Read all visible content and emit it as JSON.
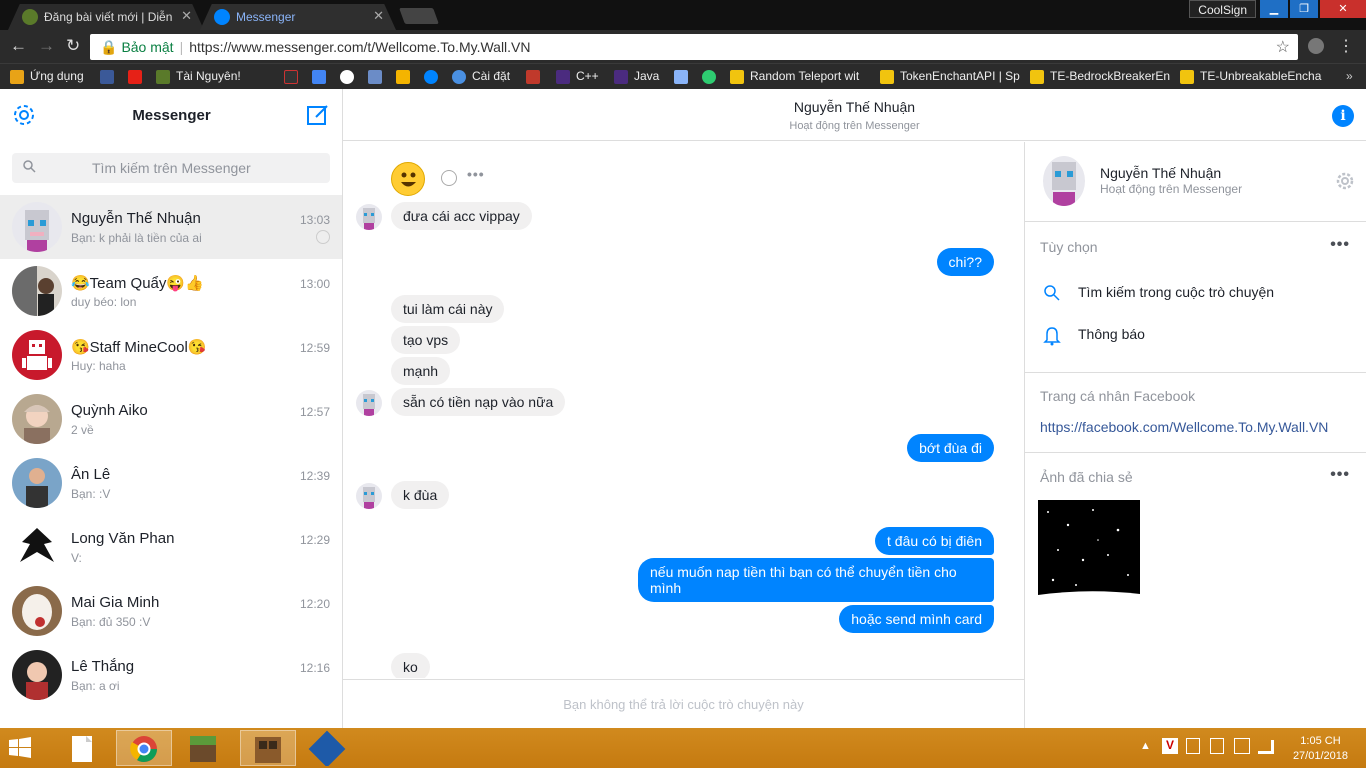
{
  "browser": {
    "tabs": [
      {
        "title": "Đăng bài viết mới | Diễn"
      },
      {
        "title": "Messenger"
      }
    ],
    "close_glyph": "✕",
    "coolsign": "CoolSign",
    "url_secure_label": "Bảo mật",
    "url": "https://www.messenger.com/t/Wellcome.To.My.Wall.VN",
    "bookmarks": [
      {
        "label": "Ứng dụng"
      },
      {
        "label": "Tài Nguyên!"
      },
      {
        "label": "Cài đặt"
      },
      {
        "label": "C++"
      },
      {
        "label": "Java"
      },
      {
        "label": "Random Teleport wit"
      },
      {
        "label": "TokenEnchantAPI | Sp"
      },
      {
        "label": "TE-BedrockBreakerEn"
      },
      {
        "label": "TE-UnbreakableEncha"
      }
    ]
  },
  "sidebar": {
    "title": "Messenger",
    "search_placeholder": "Tìm kiếm trên Messenger",
    "conversations": [
      {
        "name": "Nguyễn Thế Nhuận",
        "snippet": "Bạn: k phải là tiền của ai",
        "time": "13:03"
      },
      {
        "name": "😂Team Quẩy😜👍",
        "snippet": "duy béo: lon",
        "time": "13:00"
      },
      {
        "name": "😘Staff MineCool😘",
        "snippet": "Huy: haha",
        "time": "12:59"
      },
      {
        "name": "Quỳnh Aiko",
        "snippet": "2 về",
        "time": "12:57"
      },
      {
        "name": "Ân Lê",
        "snippet": "Bạn: :V",
        "time": "12:39"
      },
      {
        "name": "Long Văn Phan",
        "snippet": "V:",
        "time": "12:29"
      },
      {
        "name": "Mai Gia Minh",
        "snippet": "Bạn: đủ 350 :V",
        "time": "12:20"
      },
      {
        "name": "Lê Thắng",
        "snippet": "Bạn: a ơi",
        "time": "12:16"
      }
    ]
  },
  "chat": {
    "name": "Nguyễn Thế Nhuận",
    "status": "Hoạt động trên Messenger",
    "info_glyph": "i",
    "messages": [
      "đưa cái acc vippay",
      "chi??",
      "tui làm cái này",
      "tạo vps",
      "mạnh",
      "sẵn có tiền nạp vào nữa",
      "bớt đùa đi",
      "k đùa",
      "t đâu có bị điên",
      "nếu muốn nap tiền thì bạn có thể chuyển tiền cho mình",
      "hoặc send mình card",
      "ko"
    ],
    "composer_notice": "Bạn không thể trả lời cuộc trò chuyện này"
  },
  "details": {
    "name": "Nguyễn Thế Nhuận",
    "status": "Hoạt động trên Messenger",
    "options_title": "Tùy chọn",
    "option_search": "Tìm kiếm trong cuộc trò chuyện",
    "option_notify": "Thông báo",
    "profile_title": "Trang cá nhân Facebook",
    "profile_link": "https://facebook.com/Wellcome.To.My.Wall.VN",
    "shared_title": "Ảnh đã chia sẻ"
  },
  "taskbar": {
    "time": "1:05 CH",
    "date": "27/01/2018"
  },
  "colors": {
    "accent": "#0084ff",
    "taskbar": "#c57a10"
  }
}
